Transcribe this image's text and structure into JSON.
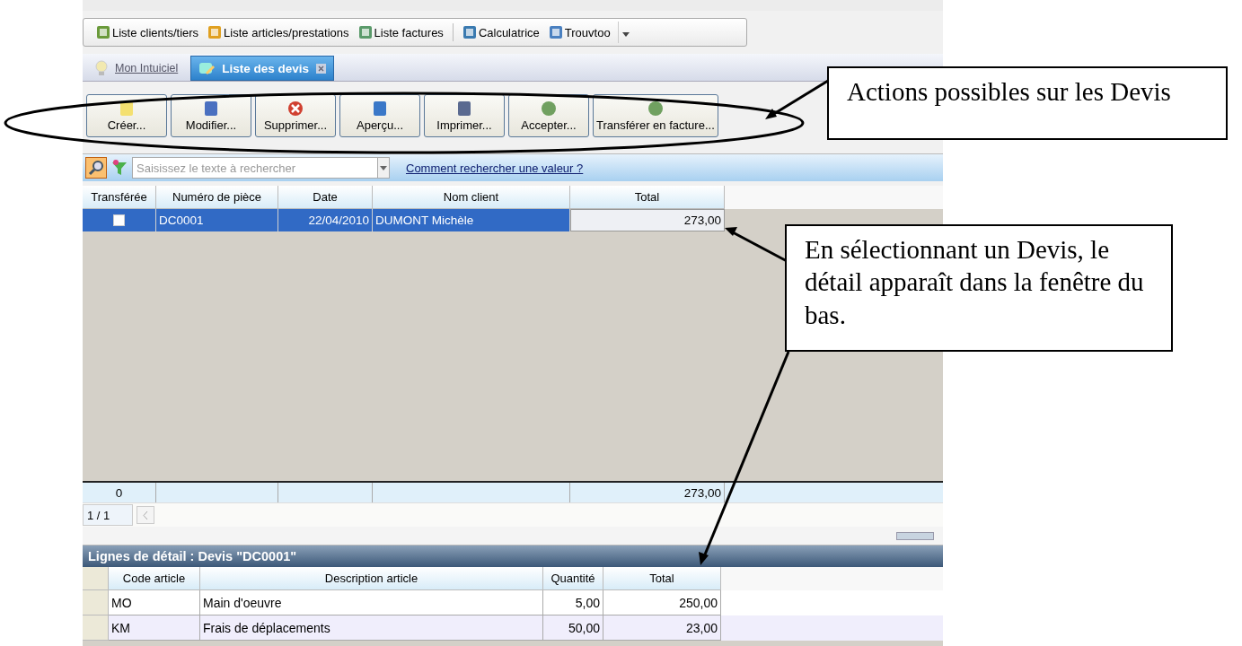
{
  "toolbar": [
    {
      "label": "Liste clients/tiers"
    },
    {
      "label": "Liste articles/prestations"
    },
    {
      "label": "Liste factures"
    },
    {
      "label": "Calculatrice"
    },
    {
      "label": "Trouvtoo"
    }
  ],
  "tabs": [
    {
      "label": "Mon Intuiciel",
      "selected": false
    },
    {
      "label": "Liste des devis",
      "selected": true
    }
  ],
  "actions": [
    "Créer...",
    "Modifier...",
    "Supprimer...",
    "Aperçu...",
    "Imprimer...",
    "Accepter...",
    "Transférer en facture..."
  ],
  "search": {
    "placeholder": "Saisissez le texte à rechercher",
    "help_link": "Comment rechercher une valeur ?"
  },
  "table": {
    "columns": [
      "Transférée",
      "Numéro de pièce",
      "Date",
      "Nom client",
      "Total"
    ],
    "rows": [
      {
        "transferred": false,
        "number": "DC0001",
        "date": "22/04/2010",
        "client": "DUMONT Michèle",
        "total": "273,00",
        "selected": true
      }
    ],
    "footer": {
      "count": "0",
      "total": "273,00"
    }
  },
  "pager": "1 / 1",
  "detail": {
    "title": "Lignes de détail : Devis \"DC0001\"",
    "columns": [
      "Code article",
      "Description article",
      "Quantité",
      "Total"
    ],
    "rows": [
      {
        "code": "MO",
        "description": "Main d'oeuvre",
        "quantity": "5,00",
        "total": "250,00"
      },
      {
        "code": "KM",
        "description": "Frais de déplacements",
        "quantity": "50,00",
        "total": "23,00"
      }
    ]
  },
  "annotations": [
    {
      "text": "Actions possibles sur les Devis"
    },
    {
      "text": "En sélectionnant un Devis, le détail apparaît dans la fenêtre du bas."
    }
  ]
}
